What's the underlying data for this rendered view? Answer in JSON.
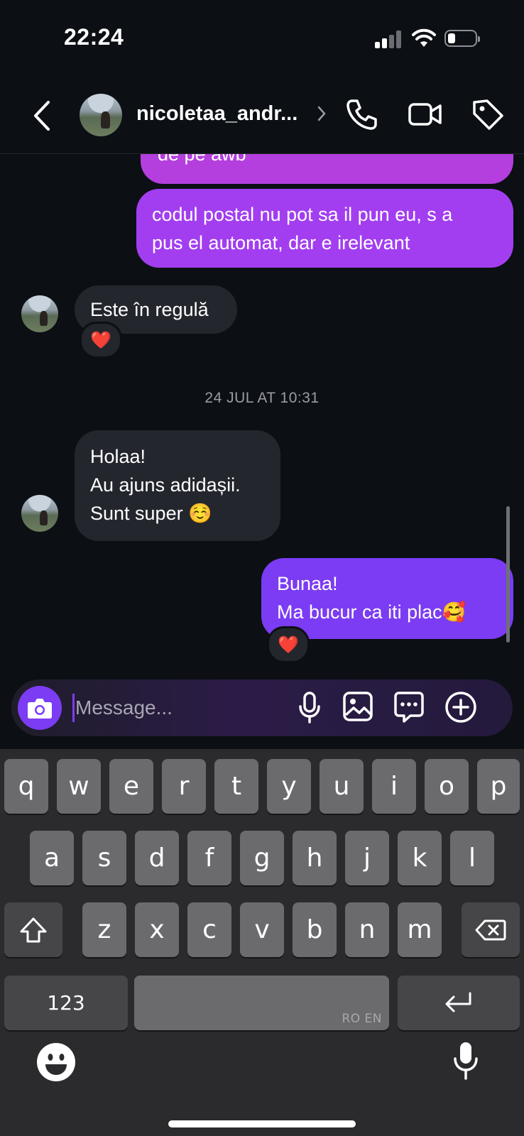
{
  "status_bar": {
    "time": "22:24"
  },
  "header": {
    "username": "nicoletaa_andr...",
    "actions": [
      "phone-icon",
      "video-icon",
      "tag-icon"
    ]
  },
  "messages": [
    {
      "from": "me",
      "text": [
        "de pe awb"
      ]
    },
    {
      "from": "me",
      "text": [
        "codul postal nu pot sa il pun eu, s a",
        "pus el automat, dar e irelevant"
      ]
    },
    {
      "from": "them",
      "text": [
        "Este în regulă"
      ],
      "reaction": "❤️"
    },
    {
      "from": "me",
      "text": [
        "Bunaa!",
        "Ma bucur ca iti plac🥰"
      ],
      "reaction": "❤️"
    }
  ],
  "timestamp": "24 JUL AT 10:31",
  "incoming_second": {
    "text": [
      "Holaa!",
      "Au ajuns adidașii.",
      "Sunt super ☺️"
    ]
  },
  "composer": {
    "placeholder": "Message..."
  },
  "keyboard": {
    "row1": [
      "q",
      "w",
      "e",
      "r",
      "t",
      "y",
      "u",
      "i",
      "o",
      "p"
    ],
    "row2": [
      "a",
      "s",
      "d",
      "f",
      "g",
      "h",
      "j",
      "k",
      "l"
    ],
    "row3": [
      "z",
      "x",
      "c",
      "v",
      "b",
      "n",
      "m"
    ],
    "numbers_label": "123",
    "language_label": "RO EN",
    "emoji": "😀"
  },
  "colors": {
    "accent": "#7b3cf3",
    "outgoing_top": "#b53fde",
    "incoming": "#23262d",
    "background": "#0c0f14"
  }
}
